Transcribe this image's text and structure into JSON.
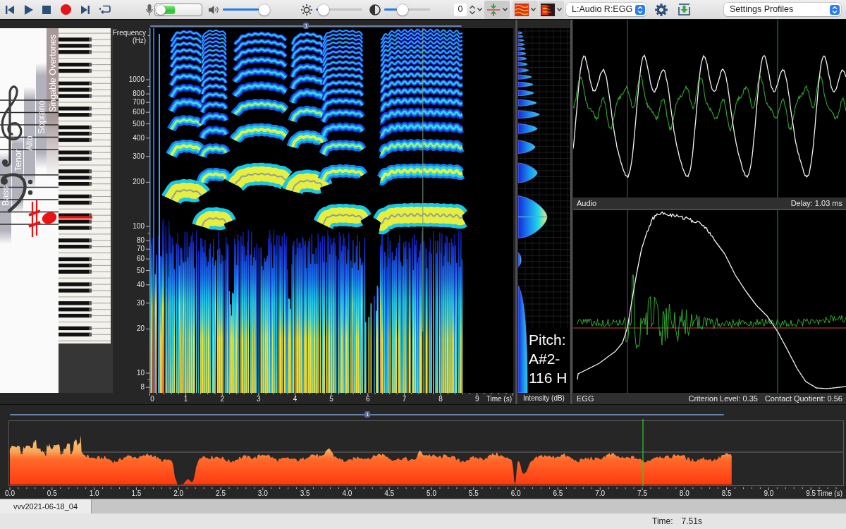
{
  "toolbar": {
    "input_meter": {
      "level": 0.42
    },
    "volume": {
      "level": 0.88
    },
    "brightness": {
      "level": 0.17
    },
    "contrast": {
      "level": 0.4
    },
    "offset_field": {
      "value": "0"
    },
    "channel_select": {
      "value": "L:Audio R:EGG"
    },
    "profile_select": {
      "value": "Settings Profiles"
    }
  },
  "staff": {
    "voice_ranges": [
      {
        "label": "Bass"
      },
      {
        "label": "Tenor"
      },
      {
        "label": "Alto"
      },
      {
        "label": "Soprano"
      },
      {
        "label": "Singable Overtones"
      }
    ]
  },
  "spectrogram": {
    "selection_label": "1",
    "y_title": "Frequency (Hz)",
    "y_ticks": [
      "1000",
      "800",
      "700",
      "600",
      "500",
      "400",
      "300",
      "200",
      "100",
      "80",
      "70",
      "60",
      "50",
      "40",
      "30",
      "20",
      "10",
      "8"
    ],
    "x_ticks": [
      "0",
      "1",
      "2",
      "3",
      "4",
      "5",
      "6",
      "7",
      "8",
      "9"
    ],
    "x_title": "Time (s)"
  },
  "spectrum": {
    "pitch_readout": [
      "Pitch:",
      "A#2-",
      "116 H"
    ],
    "x_title": "Intensity (dB)"
  },
  "audio_panel": {
    "label": "Audio",
    "info": [
      "Delay: 1.03 ms"
    ]
  },
  "egg_panel": {
    "label": "EGG",
    "info": [
      "Criterion Level: 0.35",
      "Contact Quotient: 0.56"
    ]
  },
  "overview": {
    "selection_label": "1",
    "x_ticks": [
      "0.0",
      "0.5",
      "1.0",
      "1.5",
      "2.0",
      "2.5",
      "3.0",
      "3.5",
      "4.0",
      "4.5",
      "5.0",
      "5.5",
      "6.0",
      "6.5",
      "7.0",
      "7.5",
      "8.0",
      "8.5",
      "9.0",
      "9.5"
    ],
    "x_title": "Time (s)"
  },
  "tabs": [
    {
      "label": "vvv2021-06-18_04",
      "selected": true
    }
  ],
  "status_bar": {
    "label": "Time:",
    "value": "7.51s"
  }
}
